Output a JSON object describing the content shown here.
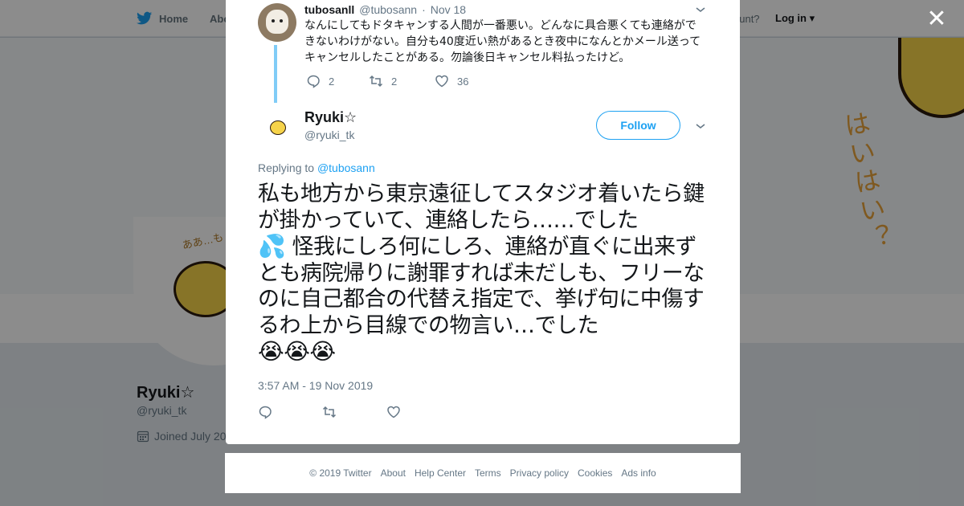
{
  "nav": {
    "home_label": "Home",
    "about_label": "Abo",
    "account_text": "ccount?",
    "login_label": "Log in"
  },
  "banner": {
    "art_text": "はいはい？"
  },
  "avatar_note": "ああ…も 限",
  "profile": {
    "name": "Ryuki☆",
    "handle": "@ryuki_tk",
    "joined": "Joined July 20"
  },
  "parent_tweet": {
    "name": "tubosanll",
    "handle": "@tubosann",
    "separator": "·",
    "date": "Nov 18",
    "text": "なんにしてもドタキャンする人間が一番悪い。どんなに具合悪くても連絡ができないわけがない。自分も40度近い熱があるとき夜中になんとかメール送ってキャンセルしたことがある。勿論後日キャンセル料払ったけど。",
    "reply_count": "2",
    "retweet_count": "2",
    "like_count": "36"
  },
  "tweet": {
    "author_name": "Ryuki☆",
    "author_handle": "@ryuki_tk",
    "follow_label": "Follow",
    "replying_prefix": "Replying to",
    "replying_to": "@tubosann",
    "text_part1": "私も地方から東京遠征してスタジオ着いたら鍵が掛かっていて、連絡したら……でした",
    "emoji_sweat": "💦",
    "text_part2": " 怪我にしろ何にしろ、連絡が直ぐに出来ずとも病院帰りに謝罪すれば未だしも、フリーなのに自己都合の代替え指定で、挙げ句に中傷するわ上から目線での物言い…でした",
    "emoji_cry": "😭😭😭",
    "timestamp": "3:57 AM - 19 Nov 2019"
  },
  "footer": {
    "links": [
      "© 2019 Twitter",
      "About",
      "Help Center",
      "Terms",
      "Privacy policy",
      "Cookies",
      "Ads info"
    ]
  },
  "colors": {
    "accent": "#1da1f2",
    "thread_line": "#80ccf7",
    "muted": "#657786"
  },
  "icons": [
    "twitter-bird-icon",
    "close-icon",
    "chevron-down-icon",
    "reply-icon",
    "retweet-icon",
    "like-icon",
    "calendar-icon"
  ]
}
